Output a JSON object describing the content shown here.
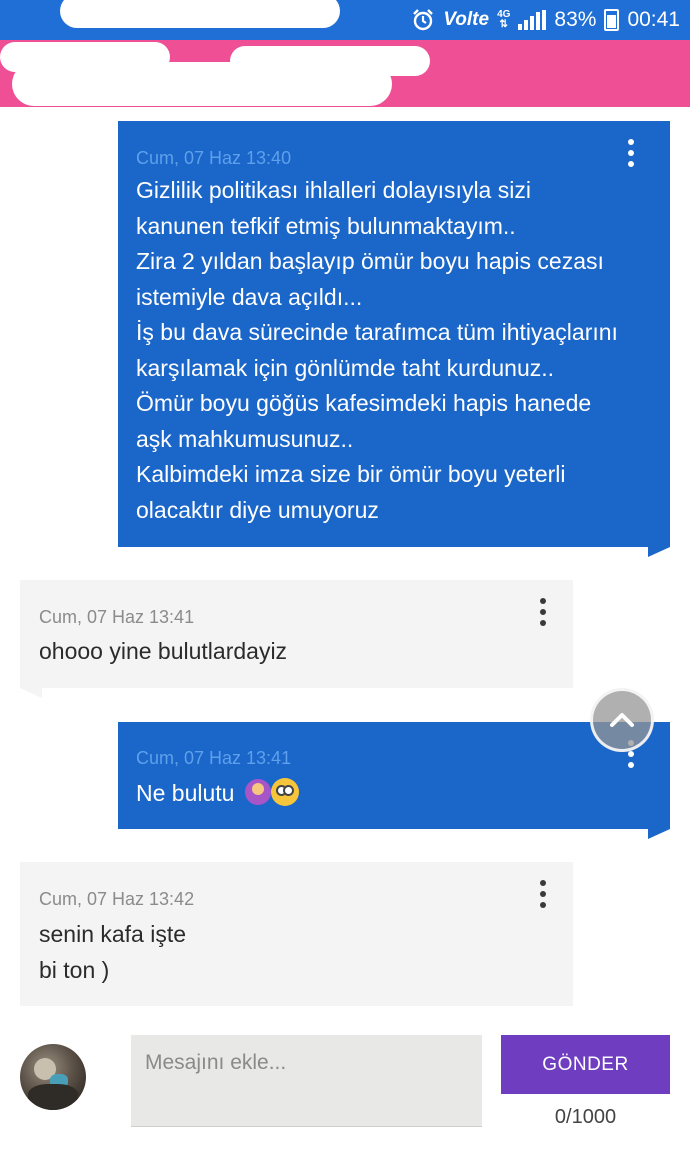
{
  "status_bar": {
    "volte": "Volte",
    "network": "4G",
    "battery": "83%",
    "time": "00:41"
  },
  "messages": [
    {
      "direction": "sent",
      "timestamp": "Cum, 07 Haz 13:40",
      "text": "Gizlilik politikası ihlalleri dolayısıyla sizi\nkanunen tefkif etmiş bulunmaktayım..\nZira 2 yıldan başlayıp ömür boyu hapis cezası\nistemiyle dava açıldı...\nİş bu dava sürecinde tarafımca tüm ihtiyaçlarını\nkarşılamak için gönlümde taht kurdunuz..\nÖmür boyu göğüs kafesimdeki hapis hanede\naşk mahkumusunuz..\nKalbimdeki imza size bir ömür boyu yeterli\nolacaktır diye umuyoruz"
    },
    {
      "direction": "received",
      "timestamp": "Cum, 07 Haz 13:41",
      "text": "ohooo yine bulutlardayiz"
    },
    {
      "direction": "sent",
      "timestamp": "Cum, 07 Haz 13:41",
      "text": "Ne bulutu",
      "emojis": [
        "person-shrugging-emoji",
        "face-with-rolling-eyes-emoji"
      ]
    },
    {
      "direction": "received",
      "timestamp": "Cum, 07 Haz 13:42",
      "text": "senin kafa işte\nbi ton )"
    }
  ],
  "composer": {
    "placeholder": "Mesajını ekle...",
    "send_label": "GÖNDER",
    "char_count": "0/1000"
  },
  "colors": {
    "status_bar": "#1f6fd6",
    "header": "#ef4f94",
    "sent_bubble": "#1b66c9",
    "received_bubble": "#f4f4f4",
    "send_button": "#6f3ec0"
  }
}
